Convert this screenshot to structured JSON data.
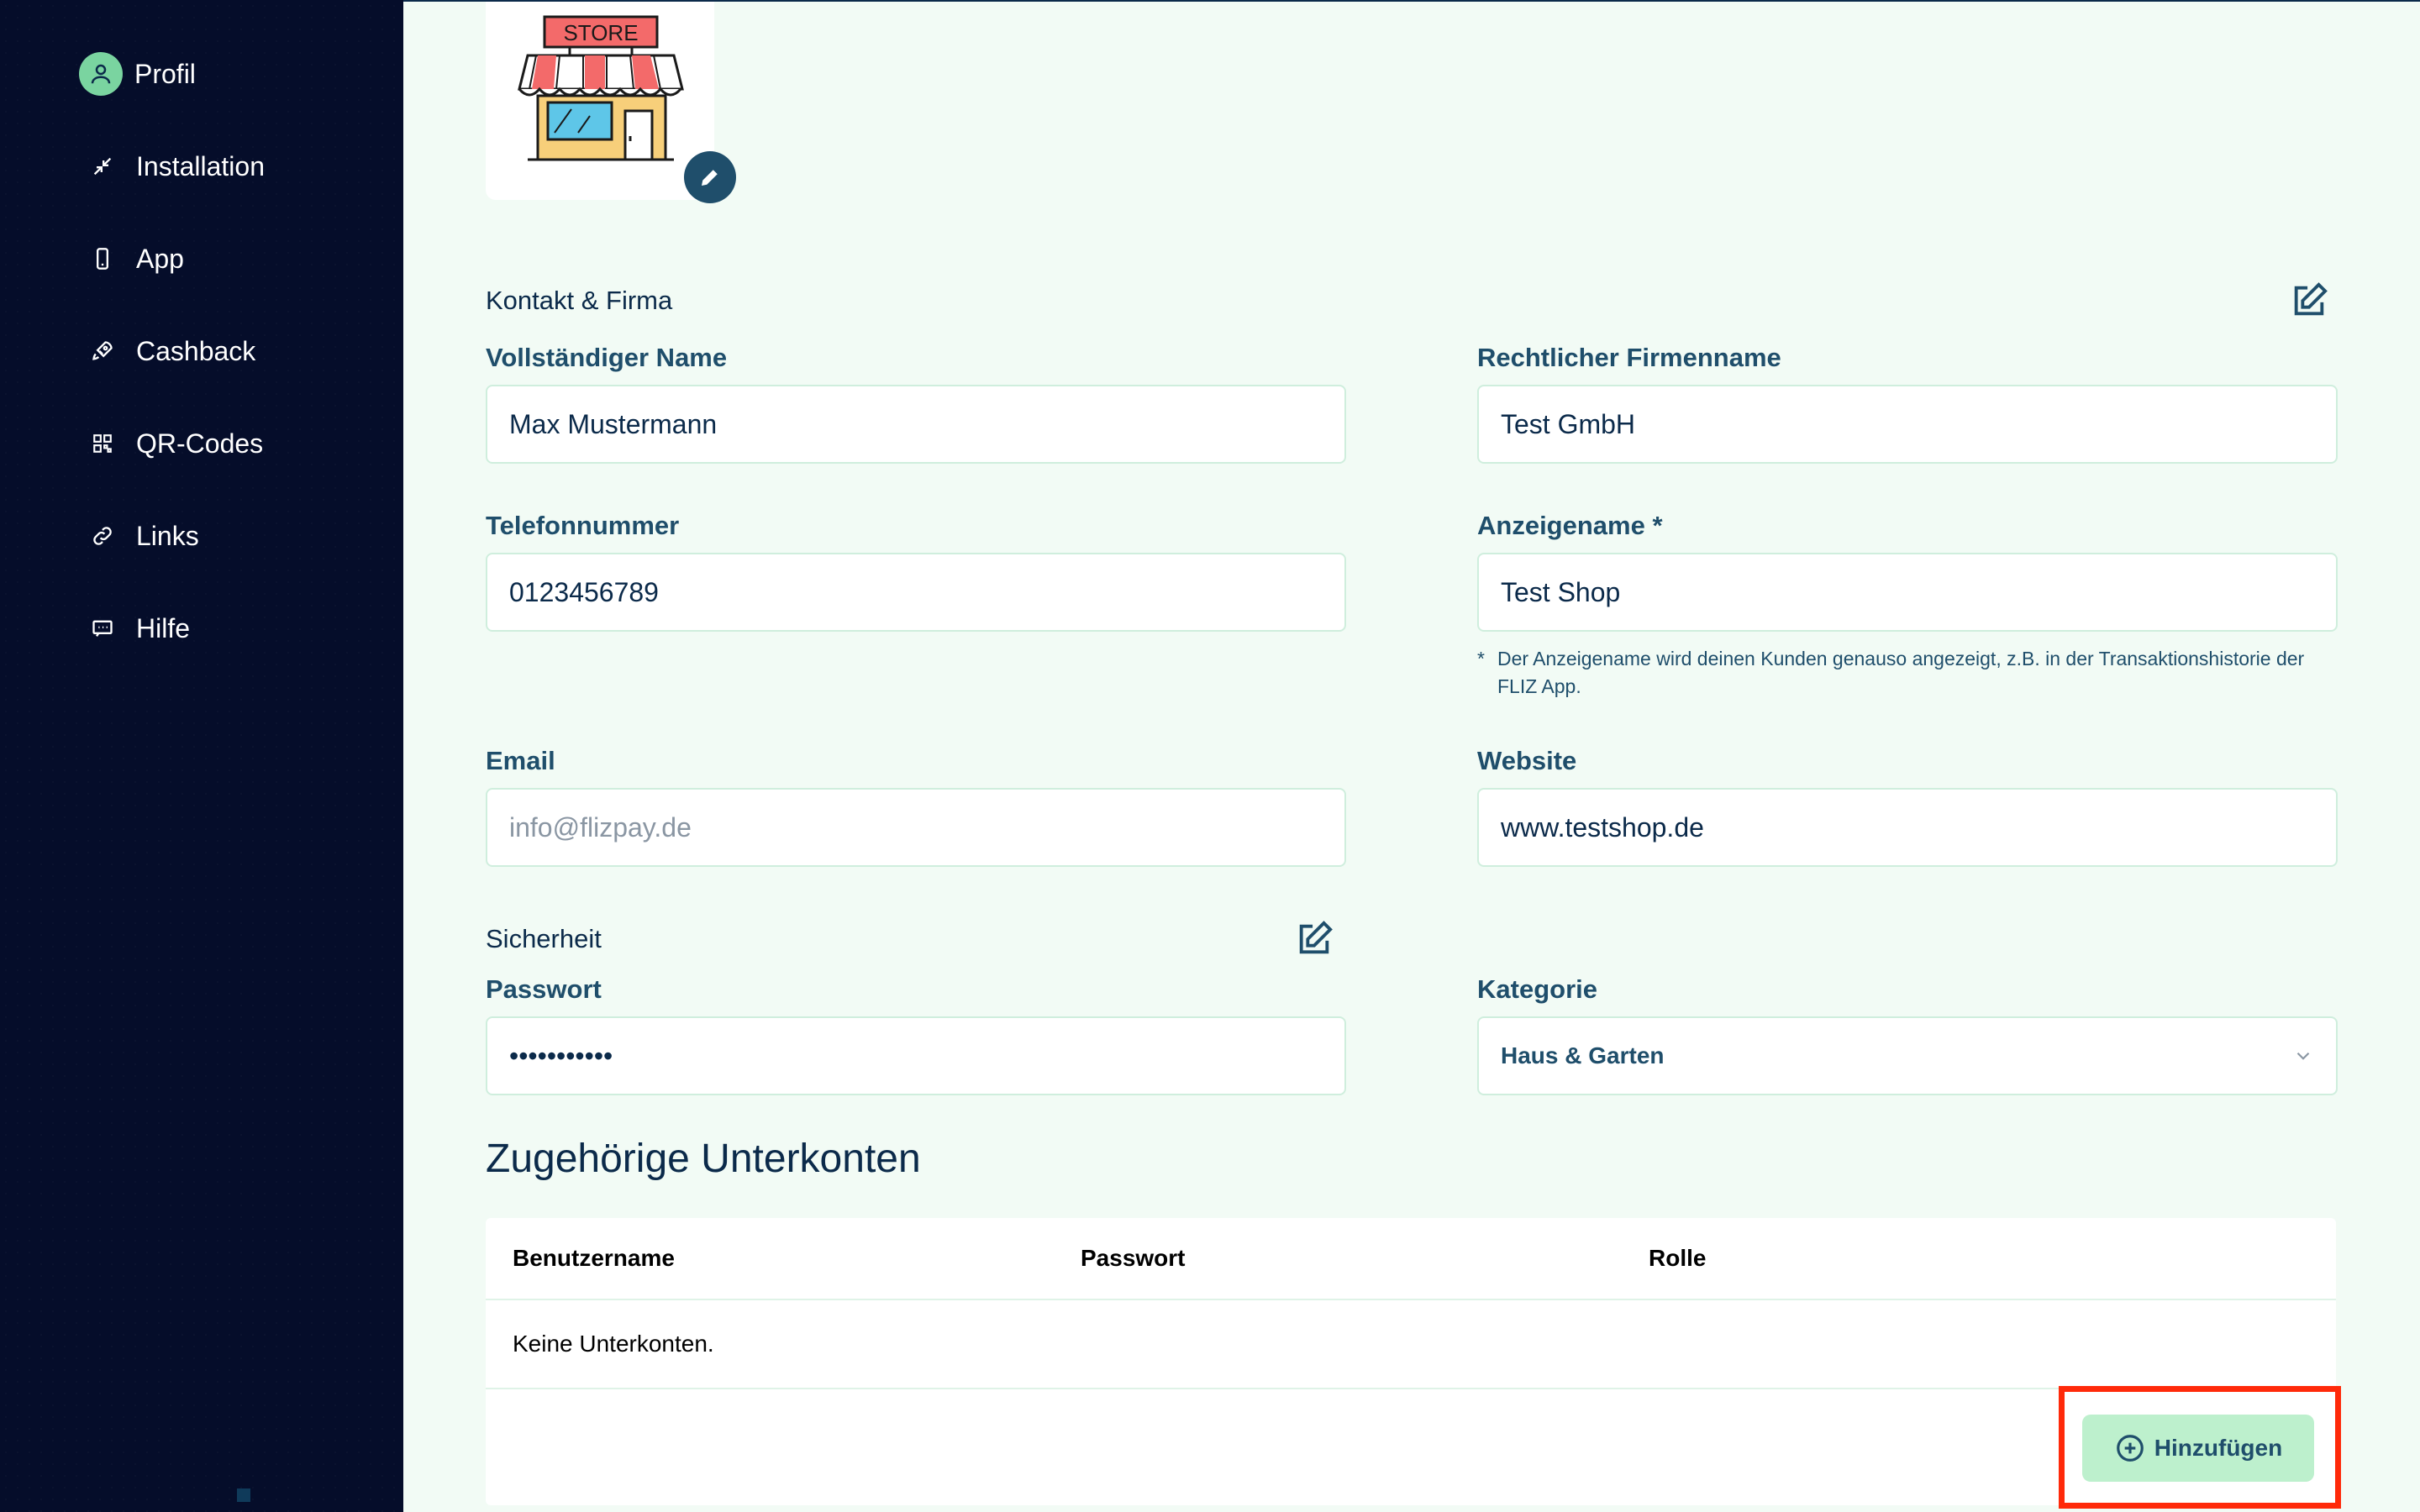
{
  "sidebar": {
    "items": [
      {
        "label": "Profil",
        "icon": "user-icon"
      },
      {
        "label": "Installation",
        "icon": "arrows-icon"
      },
      {
        "label": "App",
        "icon": "phone-icon"
      },
      {
        "label": "Cashback",
        "icon": "rocket-icon"
      },
      {
        "label": "QR-Codes",
        "icon": "qr-icon"
      },
      {
        "label": "Links",
        "icon": "link-icon"
      },
      {
        "label": "Hilfe",
        "icon": "chat-icon"
      }
    ]
  },
  "logo": {
    "text": "STORE"
  },
  "contact": {
    "title": "Kontakt & Firma",
    "full_name_label": "Vollständiger Name",
    "full_name_value": "Max Mustermann",
    "legal_name_label": "Rechtlicher Firmenname",
    "legal_name_value": "Test GmbH",
    "phone_label": "Telefonnummer",
    "phone_value": "0123456789",
    "display_name_label": "Anzeigename *",
    "display_name_value": "Test Shop",
    "display_name_note_star": "*",
    "display_name_note": "Der Anzeigename wird deinen Kunden genauso angezeigt, z.B. in der Transaktionshistorie der FLIZ App.",
    "email_label": "Email",
    "email_value": "info@flizpay.de",
    "website_label": "Website",
    "website_value": "www.testshop.de"
  },
  "security": {
    "title": "Sicherheit",
    "password_label": "Passwort",
    "password_value": "•••••••••••"
  },
  "category": {
    "label": "Kategorie",
    "value": "Haus & Garten"
  },
  "subaccounts": {
    "title": "Zugehörige Unterkonten",
    "columns": [
      "Benutzername",
      "Passwort",
      "Rolle"
    ],
    "empty_text": "Keine Unterkonten.",
    "add_label": "Hinzufügen"
  },
  "colors": {
    "sidebar_bg": "#050d2a",
    "main_bg": "#f2fbf5",
    "accent_green": "#7ad4a0",
    "primary_text": "#1f4e6b",
    "highlight": "#ff2a0a"
  }
}
